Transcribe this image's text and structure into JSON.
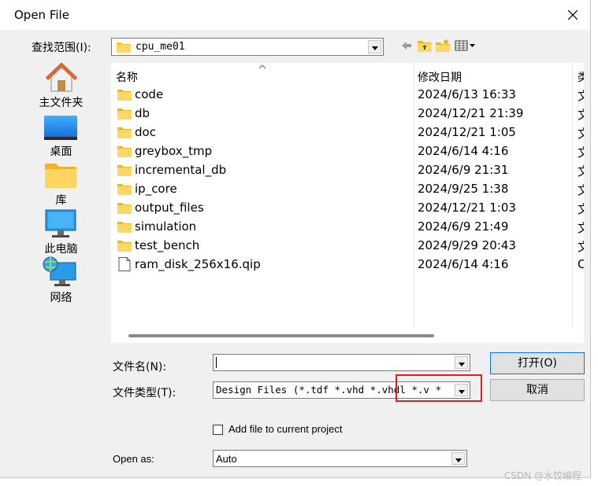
{
  "window": {
    "title": "Open File"
  },
  "lookin": {
    "label": "查找范围(I):",
    "value": "cpu_me01"
  },
  "places": [
    {
      "label": "主文件夹",
      "icon": "home-icon"
    },
    {
      "label": "桌面",
      "icon": "desktop-icon"
    },
    {
      "label": "库",
      "icon": "library-folder-icon"
    },
    {
      "label": "此电脑",
      "icon": "computer-icon"
    },
    {
      "label": "网络",
      "icon": "network-icon"
    }
  ],
  "columns": {
    "name": "名称",
    "date": "修改日期",
    "type": "类"
  },
  "files": [
    {
      "name": "code",
      "date": "2024/6/13 16:33",
      "type": "文",
      "icon": "folder-icon"
    },
    {
      "name": "db",
      "date": "2024/12/21 21:39",
      "type": "文",
      "icon": "folder-icon"
    },
    {
      "name": "doc",
      "date": "2024/12/21 1:05",
      "type": "文",
      "icon": "folder-icon"
    },
    {
      "name": "greybox_tmp",
      "date": "2024/6/14 4:16",
      "type": "文",
      "icon": "folder-icon"
    },
    {
      "name": "incremental_db",
      "date": "2024/6/9 21:31",
      "type": "文",
      "icon": "folder-icon"
    },
    {
      "name": "ip_core",
      "date": "2024/9/25 1:38",
      "type": "文",
      "icon": "folder-icon"
    },
    {
      "name": "output_files",
      "date": "2024/12/21 1:03",
      "type": "文",
      "icon": "folder-icon"
    },
    {
      "name": "simulation",
      "date": "2024/6/9 21:49",
      "type": "文",
      "icon": "folder-icon"
    },
    {
      "name": "test_bench",
      "date": "2024/9/29 20:43",
      "type": "文",
      "icon": "folder-icon"
    },
    {
      "name": "ram_disk_256x16.qip",
      "date": "2024/6/14 4:16",
      "type": "C",
      "icon": "file-icon"
    }
  ],
  "filename": {
    "label": "文件名(N):",
    "value": ""
  },
  "filetype": {
    "label": "文件类型(T):",
    "value": "Design Files (*.tdf *.vhd *.vhdl *.v *"
  },
  "buttons": {
    "open": "打开(O)",
    "cancel": "取消"
  },
  "add_to_project": {
    "label": "Add file to current project",
    "checked": false
  },
  "open_as": {
    "label": "Open as:",
    "value": "Auto"
  },
  "watermark": "CSDN @水饺编程"
}
